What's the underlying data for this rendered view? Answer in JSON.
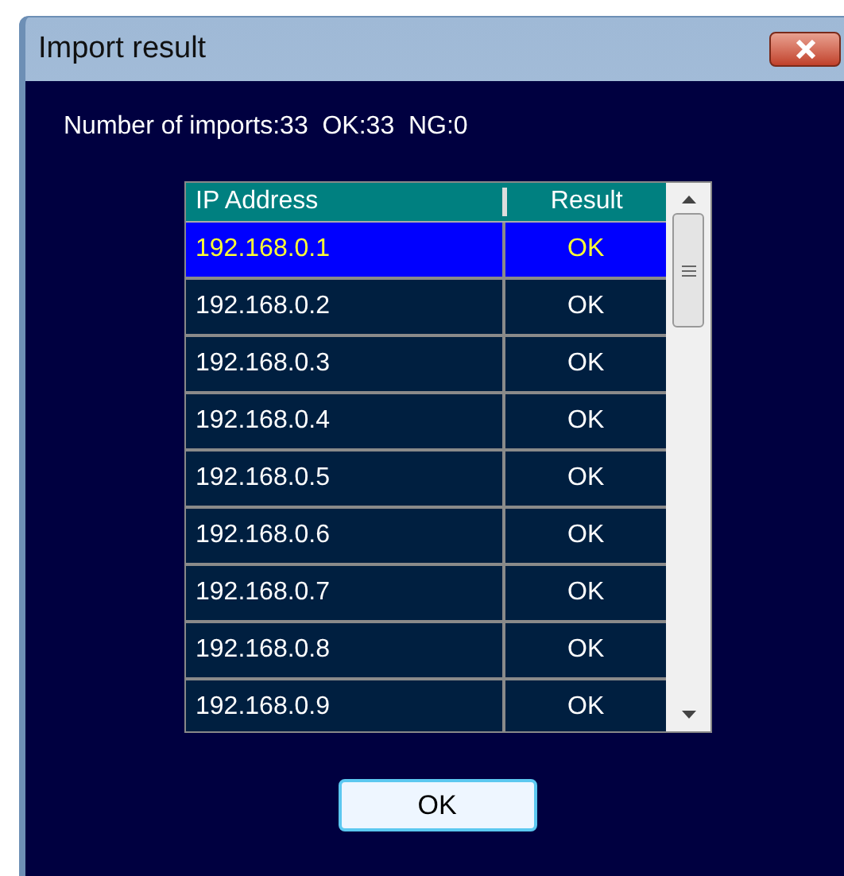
{
  "window": {
    "title": "Import result"
  },
  "summary": "Number of imports:33  OK:33  NG:0",
  "table": {
    "columns": [
      "IP Address",
      "Result"
    ],
    "rows": [
      {
        "ip": "192.168.0.1",
        "result": "OK",
        "selected": true
      },
      {
        "ip": "192.168.0.2",
        "result": "OK",
        "selected": false
      },
      {
        "ip": "192.168.0.3",
        "result": "OK",
        "selected": false
      },
      {
        "ip": "192.168.0.4",
        "result": "OK",
        "selected": false
      },
      {
        "ip": "192.168.0.5",
        "result": "OK",
        "selected": false
      },
      {
        "ip": "192.168.0.6",
        "result": "OK",
        "selected": false
      },
      {
        "ip": "192.168.0.7",
        "result": "OK",
        "selected": false
      },
      {
        "ip": "192.168.0.8",
        "result": "OK",
        "selected": false
      },
      {
        "ip": "192.168.0.9",
        "result": "OK",
        "selected": false
      }
    ]
  },
  "buttons": [
    "OK"
  ]
}
